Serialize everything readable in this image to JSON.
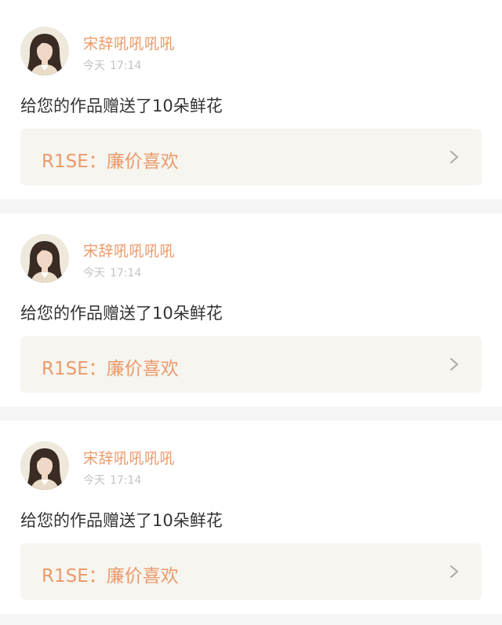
{
  "colors": {
    "accent": "#eb9a6b",
    "link_bg": "#f6f5ef",
    "divider": "#f5f5f5",
    "muted": "#c2c2c2",
    "text": "#333333"
  },
  "notifications": [
    {
      "avatar_icon": "user-avatar",
      "username": "宋辞吼吼吼吼",
      "date": "今天",
      "time": "17:14",
      "message": "给您的作品赠送了10朵鲜花",
      "work_title": "R1SE：廉价喜欢"
    },
    {
      "avatar_icon": "user-avatar",
      "username": "宋辞吼吼吼吼",
      "date": "今天",
      "time": "17:14",
      "message": "给您的作品赠送了10朵鲜花",
      "work_title": "R1SE：廉价喜欢"
    },
    {
      "avatar_icon": "user-avatar",
      "username": "宋辞吼吼吼吼",
      "date": "今天",
      "time": "17:14",
      "message": "给您的作品赠送了10朵鲜花",
      "work_title": "R1SE：廉价喜欢"
    }
  ]
}
